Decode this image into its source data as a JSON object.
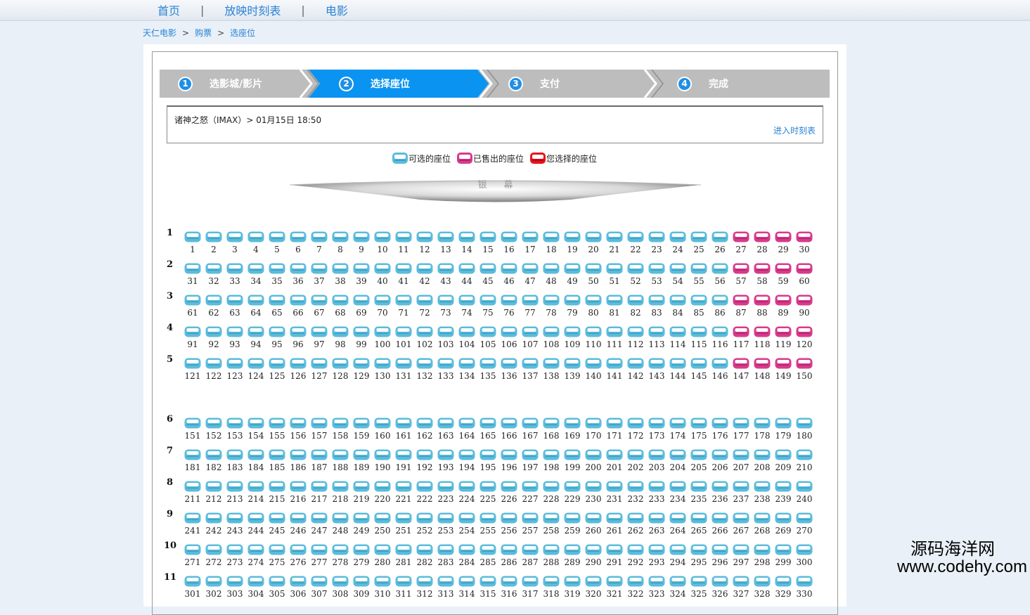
{
  "nav": {
    "home": "首页",
    "schedule": "放映时刻表",
    "movies": "电影",
    "separator": "|"
  },
  "breadcrumb": {
    "site": "天仁电影",
    "tickets": "购票",
    "current": "选座位",
    "arrow": ">"
  },
  "steps": [
    {
      "num": "1",
      "label": "选影城/影片",
      "active": false
    },
    {
      "num": "2",
      "label": "选择座位",
      "active": true
    },
    {
      "num": "3",
      "label": "支付",
      "active": false
    },
    {
      "num": "4",
      "label": "完成",
      "active": false
    }
  ],
  "movie_info": "诸神之怒（IMAX）>  01月15日 18:50",
  "schedule_link": "进入时刻表",
  "legend": {
    "available": "可选的座位",
    "sold": "已售出的座位",
    "selected": "您选择的座位"
  },
  "screen_label": "银幕",
  "colors": {
    "available": "#5bbcdc",
    "sold": "#d93a8c",
    "selected": "#e8111c",
    "active_step": "#0a93f0",
    "link": "#2a83d6"
  },
  "seat_map": {
    "seats_per_row": 30,
    "rows": [
      {
        "label": "1",
        "sold_seats": [
          27,
          28,
          29,
          30
        ]
      },
      {
        "label": "2",
        "sold_seats": [
          57,
          58,
          59,
          60
        ]
      },
      {
        "label": "3",
        "sold_seats": [
          87,
          88,
          89,
          90
        ]
      },
      {
        "label": "4",
        "sold_seats": [
          117,
          118,
          119,
          120
        ]
      },
      {
        "label": "5",
        "sold_seats": [
          147,
          148,
          149,
          150
        ]
      },
      {
        "label": "6",
        "sold_seats": []
      },
      {
        "label": "7",
        "sold_seats": []
      },
      {
        "label": "8",
        "sold_seats": []
      },
      {
        "label": "9",
        "sold_seats": []
      },
      {
        "label": "10",
        "sold_seats": []
      },
      {
        "label": "11",
        "sold_seats": []
      }
    ]
  },
  "watermark": {
    "line1": "源码海洋网",
    "line2": "www.codehy.com"
  }
}
